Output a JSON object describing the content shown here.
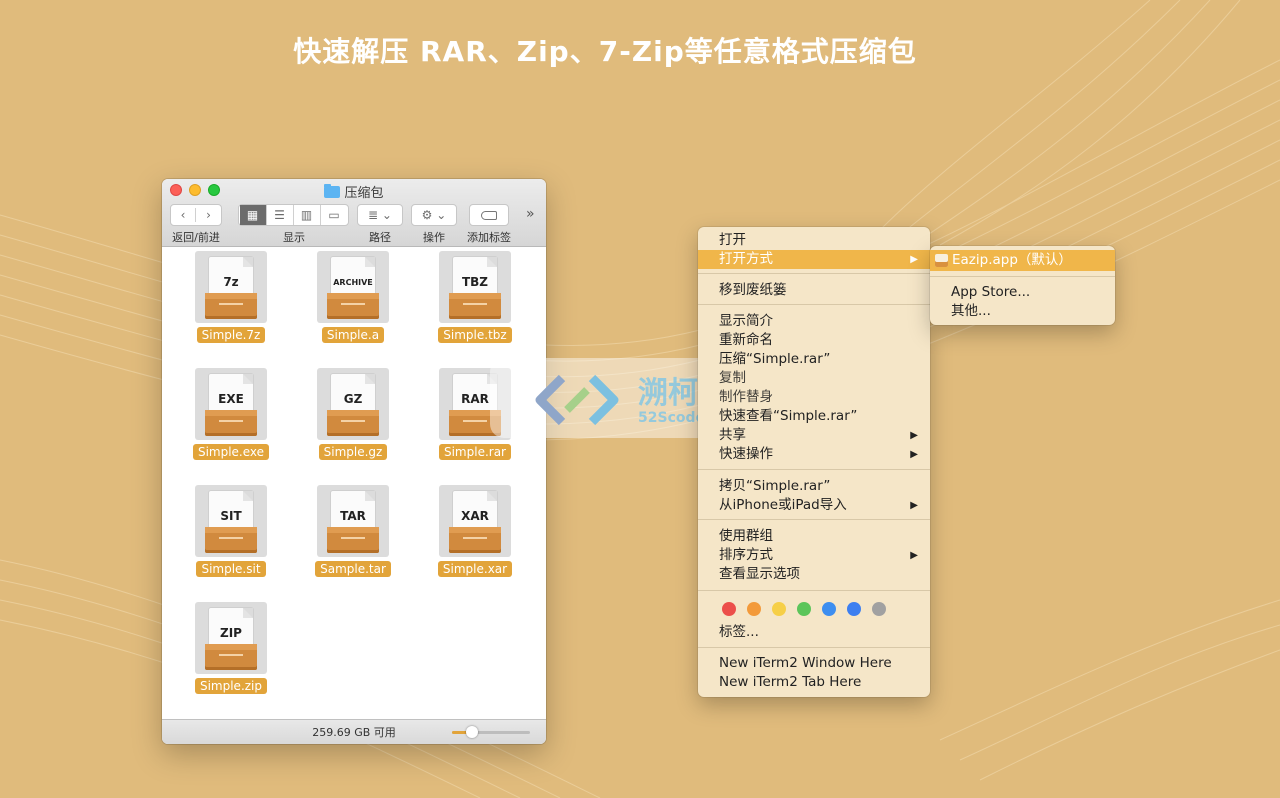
{
  "headline": "快速解压 RAR、Zip、7-Zip等任意格式压缩包",
  "finder": {
    "title": "压缩包",
    "toolbar": {
      "nav_label": "返回/前进",
      "view_label": "显示",
      "path_label": "路径",
      "action_label": "操作",
      "tag_label": "添加标签"
    },
    "files": [
      {
        "ext": "7z",
        "name": "Simple.7z"
      },
      {
        "ext": "ARCHIVE",
        "name": "Simple.a"
      },
      {
        "ext": "TBZ",
        "name": "Simple.tbz"
      },
      {
        "ext": "EXE",
        "name": "Simple.exe"
      },
      {
        "ext": "GZ",
        "name": "Simple.gz"
      },
      {
        "ext": "RAR",
        "name": "Simple.rar"
      },
      {
        "ext": "SIT",
        "name": "Simple.sit"
      },
      {
        "ext": "TAR",
        "name": "Sample.tar"
      },
      {
        "ext": "XAR",
        "name": "Simple.xar"
      },
      {
        "ext": "ZIP",
        "name": "Simple.zip"
      }
    ],
    "status": "259.69 GB 可用",
    "icon_size_level": 0.25
  },
  "watermark": {
    "text": "溯柯网",
    "url": "52Scode.Com"
  },
  "context_menu": {
    "items": [
      {
        "label": "打开"
      },
      {
        "label": "打开方式",
        "submenu": true,
        "highlighted": true
      },
      {
        "label": "移到废纸篓"
      },
      {
        "label": "显示简介"
      },
      {
        "label": "重新命名"
      },
      {
        "label": "压缩“Simple.rar”"
      },
      {
        "label": "复制"
      },
      {
        "label": "制作替身"
      },
      {
        "label": "快速查看“Simple.rar”"
      },
      {
        "label": "共享",
        "submenu": true
      },
      {
        "label": "快速操作",
        "submenu": true
      },
      {
        "label": "拷贝“Simple.rar”"
      },
      {
        "label": "从iPhone或iPad导入",
        "submenu": true
      },
      {
        "label": "使用群组"
      },
      {
        "label": "排序方式",
        "submenu": true
      },
      {
        "label": "查看显示选项"
      },
      {
        "label": "标签..."
      },
      {
        "label": "New iTerm2 Window Here"
      },
      {
        "label": "New iTerm2 Tab Here"
      }
    ],
    "tag_colors": [
      "#ec4f4a",
      "#f39a3a",
      "#f6cf47",
      "#5cc55a",
      "#3d8ef0",
      "#3d7ff0",
      "#a1a1a1"
    ]
  },
  "submenu": {
    "items": [
      {
        "label": "Eazip.app（默认）",
        "highlighted": true
      },
      {
        "label": "App Store..."
      },
      {
        "label": "其他..."
      }
    ]
  },
  "colors": {
    "background": "#e0bb7c",
    "accent": "#e2a43a",
    "menu_highlight": "#f0b64a"
  }
}
